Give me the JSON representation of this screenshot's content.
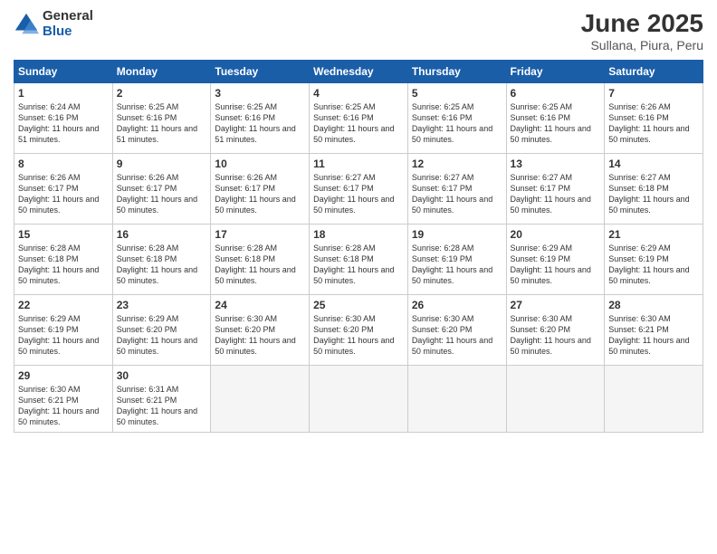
{
  "logo": {
    "general": "General",
    "blue": "Blue"
  },
  "title": "June 2025",
  "subtitle": "Sullana, Piura, Peru",
  "days_of_week": [
    "Sunday",
    "Monday",
    "Tuesday",
    "Wednesday",
    "Thursday",
    "Friday",
    "Saturday"
  ],
  "weeks": [
    [
      {
        "day": "1",
        "sunrise": "6:24 AM",
        "sunset": "6:16 PM",
        "daylight": "11 hours and 51 minutes."
      },
      {
        "day": "2",
        "sunrise": "6:25 AM",
        "sunset": "6:16 PM",
        "daylight": "11 hours and 51 minutes."
      },
      {
        "day": "3",
        "sunrise": "6:25 AM",
        "sunset": "6:16 PM",
        "daylight": "11 hours and 51 minutes."
      },
      {
        "day": "4",
        "sunrise": "6:25 AM",
        "sunset": "6:16 PM",
        "daylight": "11 hours and 50 minutes."
      },
      {
        "day": "5",
        "sunrise": "6:25 AM",
        "sunset": "6:16 PM",
        "daylight": "11 hours and 50 minutes."
      },
      {
        "day": "6",
        "sunrise": "6:25 AM",
        "sunset": "6:16 PM",
        "daylight": "11 hours and 50 minutes."
      },
      {
        "day": "7",
        "sunrise": "6:26 AM",
        "sunset": "6:16 PM",
        "daylight": "11 hours and 50 minutes."
      }
    ],
    [
      {
        "day": "8",
        "sunrise": "6:26 AM",
        "sunset": "6:17 PM",
        "daylight": "11 hours and 50 minutes."
      },
      {
        "day": "9",
        "sunrise": "6:26 AM",
        "sunset": "6:17 PM",
        "daylight": "11 hours and 50 minutes."
      },
      {
        "day": "10",
        "sunrise": "6:26 AM",
        "sunset": "6:17 PM",
        "daylight": "11 hours and 50 minutes."
      },
      {
        "day": "11",
        "sunrise": "6:27 AM",
        "sunset": "6:17 PM",
        "daylight": "11 hours and 50 minutes."
      },
      {
        "day": "12",
        "sunrise": "6:27 AM",
        "sunset": "6:17 PM",
        "daylight": "11 hours and 50 minutes."
      },
      {
        "day": "13",
        "sunrise": "6:27 AM",
        "sunset": "6:17 PM",
        "daylight": "11 hours and 50 minutes."
      },
      {
        "day": "14",
        "sunrise": "6:27 AM",
        "sunset": "6:18 PM",
        "daylight": "11 hours and 50 minutes."
      }
    ],
    [
      {
        "day": "15",
        "sunrise": "6:28 AM",
        "sunset": "6:18 PM",
        "daylight": "11 hours and 50 minutes."
      },
      {
        "day": "16",
        "sunrise": "6:28 AM",
        "sunset": "6:18 PM",
        "daylight": "11 hours and 50 minutes."
      },
      {
        "day": "17",
        "sunrise": "6:28 AM",
        "sunset": "6:18 PM",
        "daylight": "11 hours and 50 minutes."
      },
      {
        "day": "18",
        "sunrise": "6:28 AM",
        "sunset": "6:18 PM",
        "daylight": "11 hours and 50 minutes."
      },
      {
        "day": "19",
        "sunrise": "6:28 AM",
        "sunset": "6:19 PM",
        "daylight": "11 hours and 50 minutes."
      },
      {
        "day": "20",
        "sunrise": "6:29 AM",
        "sunset": "6:19 PM",
        "daylight": "11 hours and 50 minutes."
      },
      {
        "day": "21",
        "sunrise": "6:29 AM",
        "sunset": "6:19 PM",
        "daylight": "11 hours and 50 minutes."
      }
    ],
    [
      {
        "day": "22",
        "sunrise": "6:29 AM",
        "sunset": "6:19 PM",
        "daylight": "11 hours and 50 minutes."
      },
      {
        "day": "23",
        "sunrise": "6:29 AM",
        "sunset": "6:20 PM",
        "daylight": "11 hours and 50 minutes."
      },
      {
        "day": "24",
        "sunrise": "6:30 AM",
        "sunset": "6:20 PM",
        "daylight": "11 hours and 50 minutes."
      },
      {
        "day": "25",
        "sunrise": "6:30 AM",
        "sunset": "6:20 PM",
        "daylight": "11 hours and 50 minutes."
      },
      {
        "day": "26",
        "sunrise": "6:30 AM",
        "sunset": "6:20 PM",
        "daylight": "11 hours and 50 minutes."
      },
      {
        "day": "27",
        "sunrise": "6:30 AM",
        "sunset": "6:20 PM",
        "daylight": "11 hours and 50 minutes."
      },
      {
        "day": "28",
        "sunrise": "6:30 AM",
        "sunset": "6:21 PM",
        "daylight": "11 hours and 50 minutes."
      }
    ],
    [
      {
        "day": "29",
        "sunrise": "6:30 AM",
        "sunset": "6:21 PM",
        "daylight": "11 hours and 50 minutes."
      },
      {
        "day": "30",
        "sunrise": "6:31 AM",
        "sunset": "6:21 PM",
        "daylight": "11 hours and 50 minutes."
      },
      null,
      null,
      null,
      null,
      null
    ]
  ]
}
